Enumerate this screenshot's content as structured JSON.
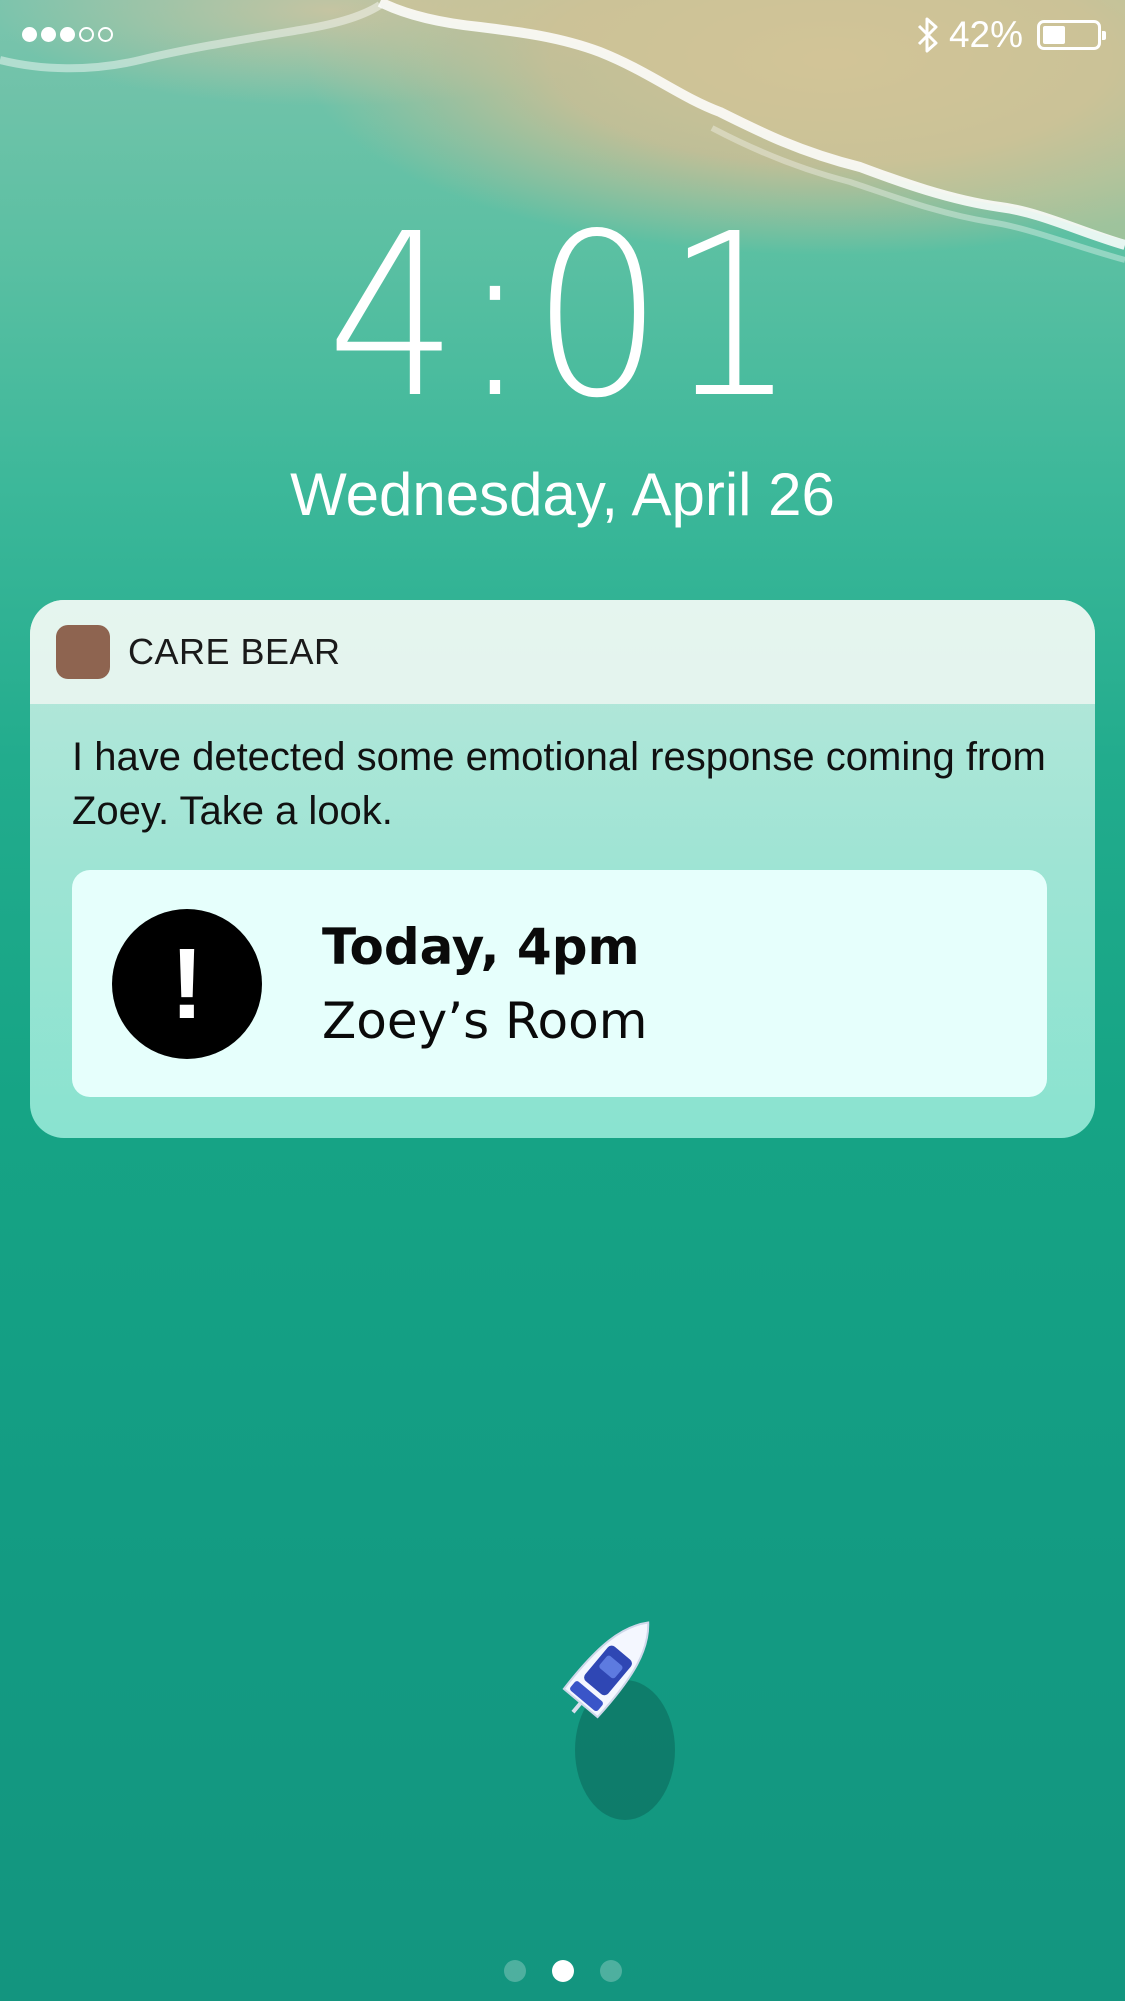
{
  "status_bar": {
    "signal_total": 5,
    "signal_filled": 3,
    "bluetooth_icon": "bluetooth-icon",
    "battery_percent_text": "42%",
    "battery_level": 0.42
  },
  "lock_screen": {
    "time": "4:01",
    "date": "Wednesday, April 26"
  },
  "notification": {
    "app_name": "CARE BEAR",
    "app_icon_color": "#8e6450",
    "message": "I have detected some emotional response coming from Zoey. Take a look.",
    "event": {
      "icon": "exclamation-icon",
      "time": "Today, 4pm",
      "location": "Zoey’s Room"
    }
  },
  "page_indicator": {
    "total": 3,
    "active_index": 1
  }
}
